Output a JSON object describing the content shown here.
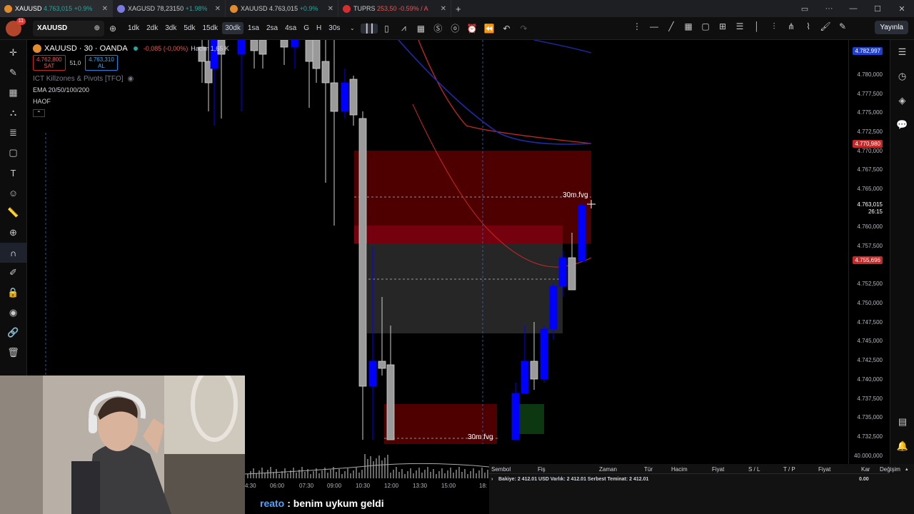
{
  "browser": {
    "tabs": [
      {
        "title": "XAUUSD",
        "price": "4.763,015",
        "change": "+0.9%",
        "dir": "up",
        "icon_color": "#e28b2c",
        "active": true
      },
      {
        "title": "XAGUSD",
        "price": "78,23150",
        "change": "+1.98%",
        "dir": "up",
        "icon_color": "#7a7ae0",
        "active": false
      },
      {
        "title": "XAUUSD",
        "price": "4.763,015",
        "change": "+0.9%",
        "dir": "up",
        "icon_color": "#e28b2c",
        "active": false
      },
      {
        "title": "TUPRS",
        "price": "253,50",
        "change": "-0.59% / A",
        "dir": "down",
        "icon_color": "#d32f2f",
        "active": false
      }
    ],
    "new_tab": "+",
    "window_controls": [
      "—",
      "☐",
      "✕"
    ]
  },
  "toolbar": {
    "notification_count": "11",
    "symbol": "XAUUSD",
    "intervals": [
      "1dk",
      "2dk",
      "3dk",
      "5dk",
      "15dk",
      "30dk",
      "1sa",
      "2sa",
      "4sa",
      "G",
      "H",
      "30s"
    ],
    "active_interval": "30dk",
    "publish_label": "Yayınla"
  },
  "legend": {
    "symbol_line": "XAUUSD · 30 · OANDA",
    "change": "-0,085 (-0,00%)",
    "volume_label": "Hacim",
    "volume_value": "1,65 K",
    "sell_price": "4.762,800",
    "sell_label": "SAT",
    "spread": "51,0",
    "buy_price": "4.763,310",
    "buy_label": "AL",
    "indicator1": "ICT Killzones & Pivots [TFO]",
    "indicator2": "EMA 20/50/100/200",
    "indicator3": "HAOF"
  },
  "price_axis": {
    "ticks": [
      "4.780,000",
      "4.777,500",
      "4.775,000",
      "4.772,500",
      "4.770,000",
      "4.767,500",
      "4.765,000",
      "4.760,000",
      "4.757,500",
      "4.752,500",
      "4.750,000",
      "4.747,500",
      "4.745,000",
      "4.742,500",
      "4.740,000",
      "4.737,500",
      "4.735,000",
      "4.732,500"
    ],
    "top_label": "4.782,997",
    "label_upper_red": "4.770,980",
    "current_price": "4.763,015",
    "countdown": "26:15",
    "label_lower_red": "4.755,696",
    "volume_axis": "40.000,000"
  },
  "annotations": {
    "fvg_upper": "30m fvg",
    "fvg_lower": "30m fvg"
  },
  "time_axis": [
    "4:30",
    "06:00",
    "07:30",
    "09:00",
    "10:30",
    "12:00",
    "13:30",
    "15:00",
    "18:"
  ],
  "trade_panel": {
    "columns": [
      "Sembol",
      "Fiş",
      "Zaman",
      "Tür",
      "Hacim",
      "Fiyat",
      "S / L",
      "T / P",
      "Fiyat",
      "Kar",
      "Değişim"
    ],
    "balance_line": "Bakiye: 2 412.01 USD  Varlık: 2 412.01  Serbest Teminat: 2 412.01",
    "profit": "0.00"
  },
  "chat": {
    "user": "reato",
    "message": ": benim uykum geldi"
  },
  "colors": {
    "bull": "#0000ff",
    "bear_outline": "#cfcfcf",
    "ema_blue": "#1e2aa8",
    "ema_red": "#c62828",
    "fvg_fill": "#5c0000",
    "gap_fill": "#2a2a2a",
    "green_box": "#0e3d12"
  }
}
